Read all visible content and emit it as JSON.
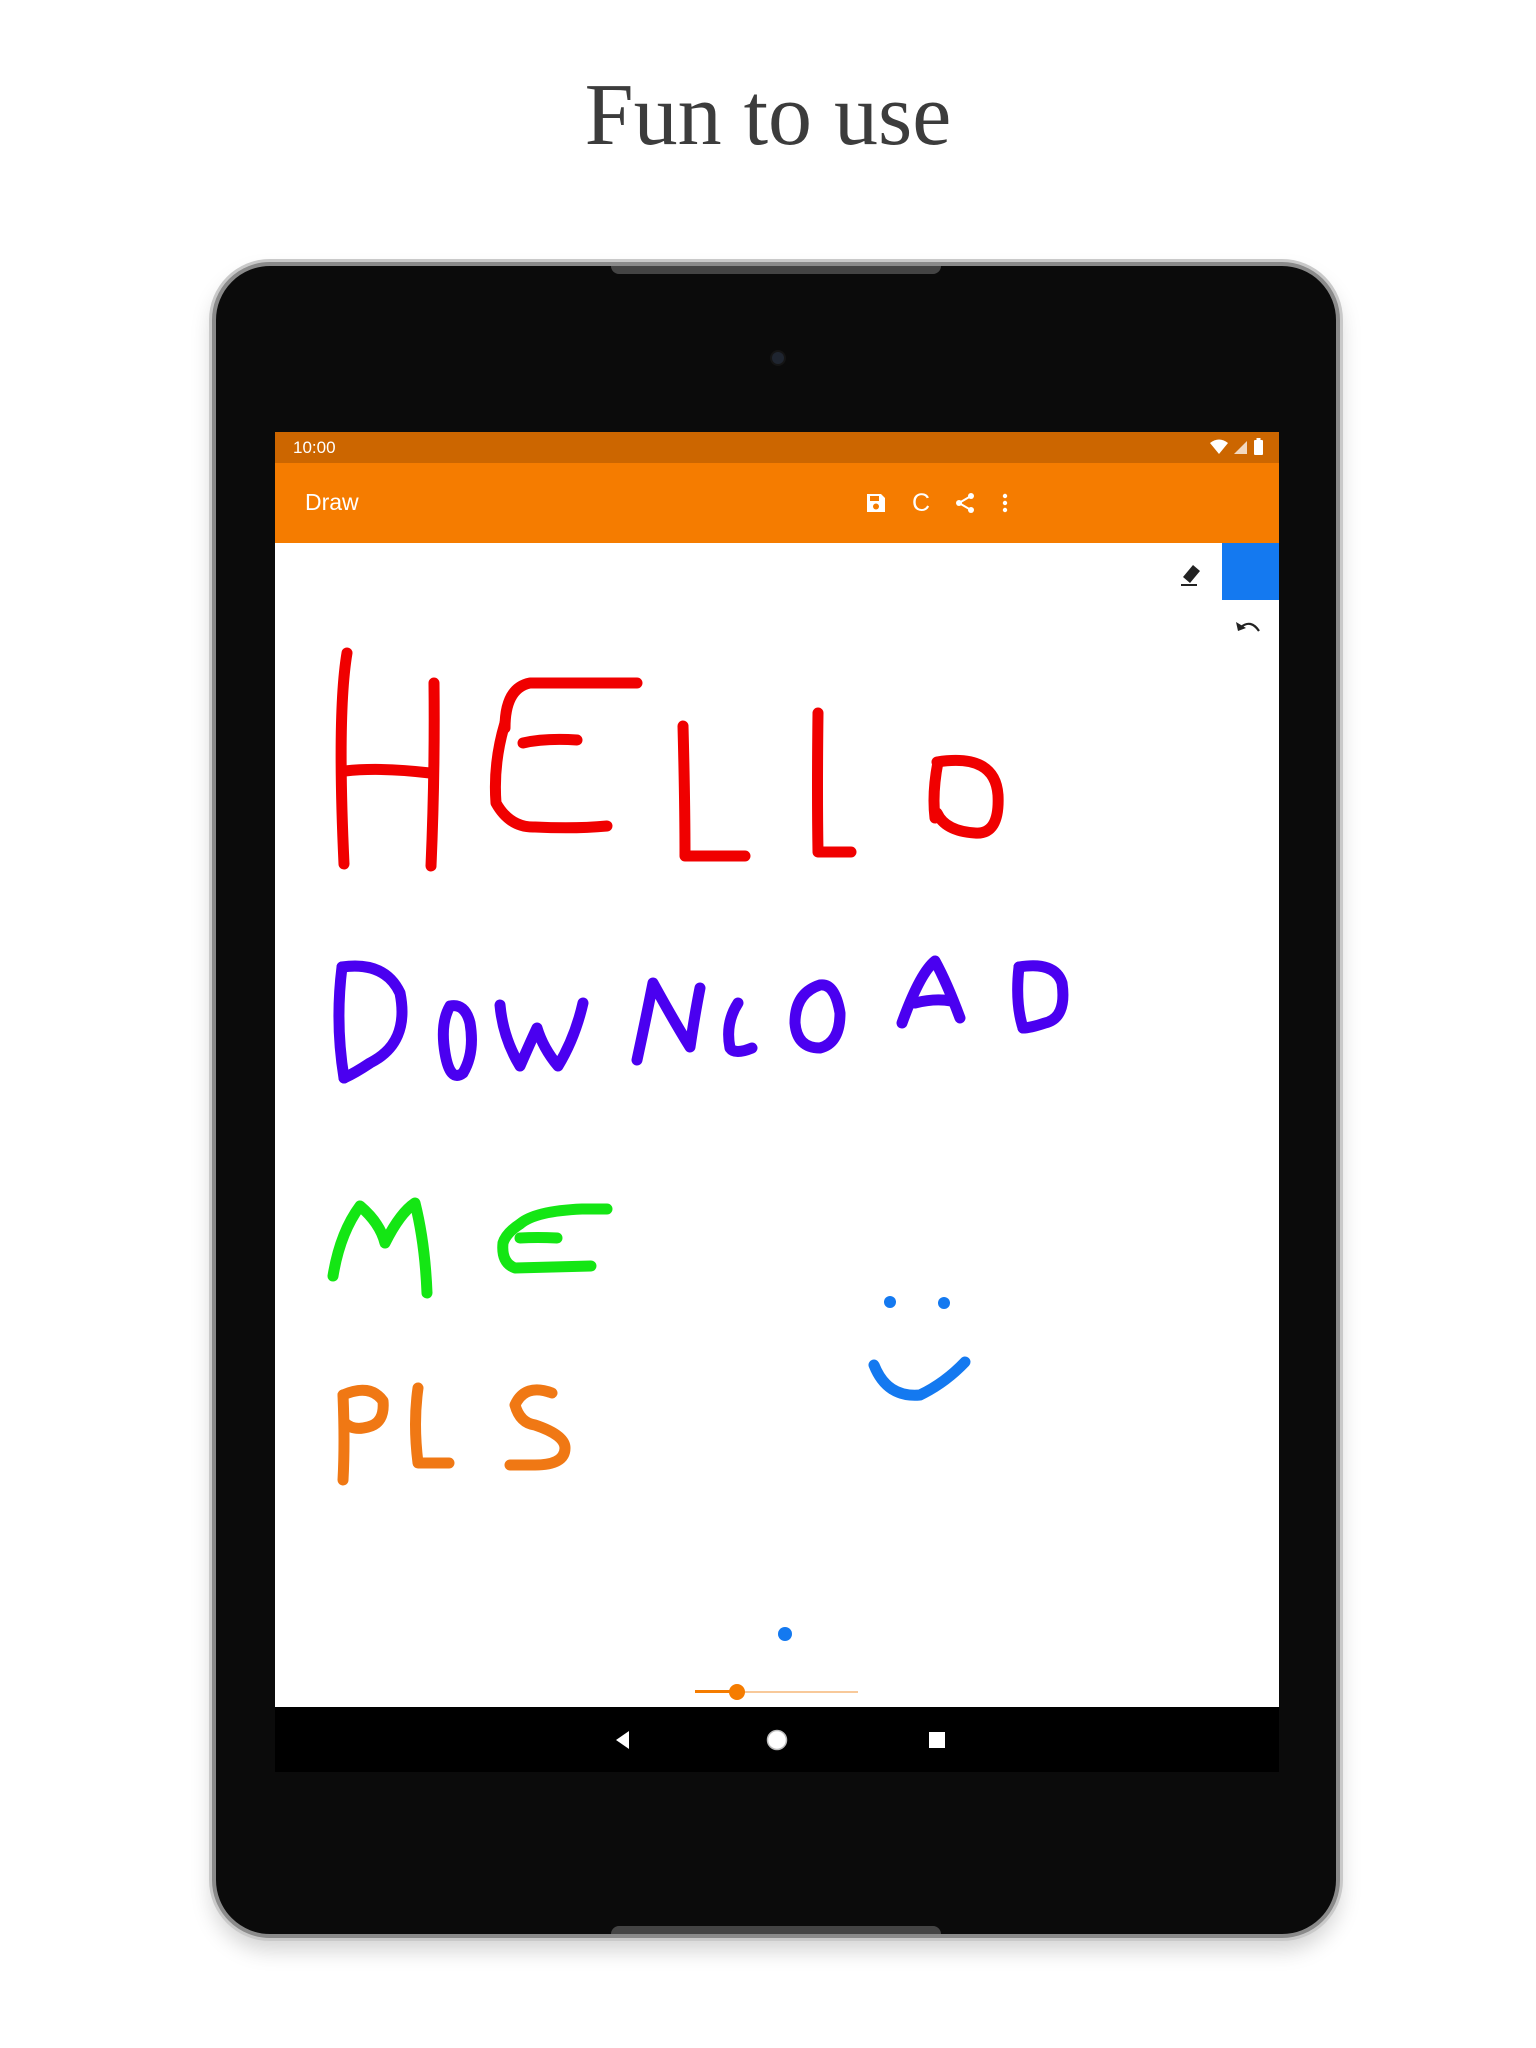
{
  "headline": "Fun to use",
  "status_bar": {
    "time": "10:00",
    "icons": [
      "wifi-icon",
      "signal-icon",
      "battery-icon"
    ]
  },
  "app_bar": {
    "title": "Draw",
    "actions": [
      {
        "name": "save-icon"
      },
      {
        "name": "clear-button",
        "label": "C"
      },
      {
        "name": "share-icon"
      },
      {
        "name": "overflow-menu-icon"
      }
    ]
  },
  "tools": {
    "eraser_icon": "eraser-icon",
    "undo_icon": "undo-icon",
    "current_color": "#1479F0"
  },
  "drawing": {
    "text_lines": [
      "HELLO",
      "DOWNLOAD",
      "ME",
      "PLS"
    ],
    "colors": {
      "hello": "#F00000",
      "download": "#4A00F0",
      "me": "#14E614",
      "pls": "#F07814",
      "smiley": "#1479F0"
    }
  },
  "brush_size": {
    "value_fraction": 0.26
  },
  "colors": {
    "accent": "#F57C00",
    "status_bar": "#CC6600"
  },
  "nav_bar": {
    "buttons": [
      "back-icon",
      "home-icon",
      "recents-icon"
    ]
  }
}
